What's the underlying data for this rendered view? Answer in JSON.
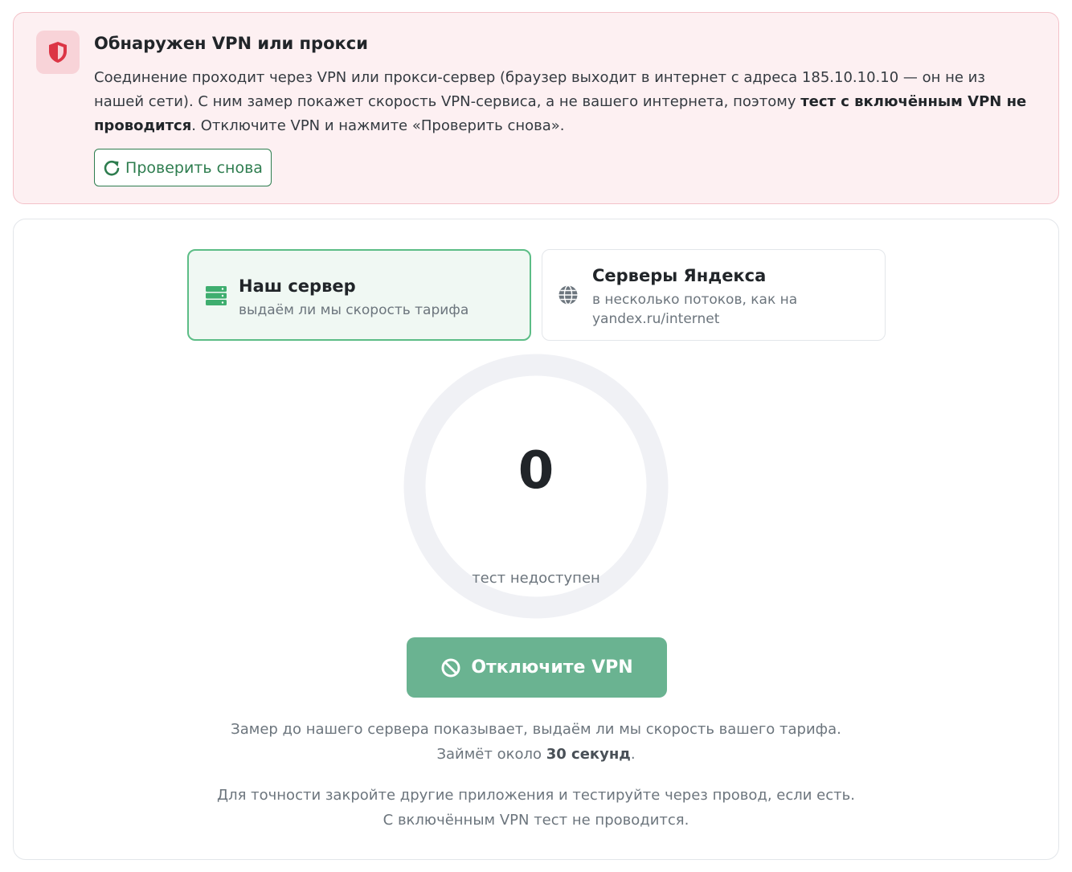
{
  "alert": {
    "title": "Обнаружен VPN или прокси",
    "text_part1": "Соединение проходит через VPN или прокси-сервер (браузер выходит в интернет с адреса 185.10.10.10 — он не из нашей сети). С ним замер покажет скорость VPN-сервиса, а не вашего интернета, поэтому ",
    "text_bold": "тест с включённым VPN не проводится",
    "text_part2": ". Отключите VPN и нажмите «Проверить снова».",
    "retry_label": "Проверить снова",
    "icon": "shield-icon",
    "accent_color": "#dc3545"
  },
  "modes": [
    {
      "title": "Наш сервер",
      "subtitle": "выдаём ли мы скорость тарифа",
      "icon": "server-icon",
      "active": true
    },
    {
      "title": "Серверы Яндекса",
      "subtitle": "в несколько потоков, как на yandex.ru/internet",
      "icon": "globe-icon",
      "active": false
    }
  ],
  "gauge": {
    "value": "0",
    "status": "тест недоступен",
    "fill_fraction": 0
  },
  "start_button": {
    "label": "Отключите VPN",
    "icon": "ban-icon",
    "disabled": true,
    "color": "#6ab391"
  },
  "info": {
    "p1_part1": "Замер до нашего сервера показывает, выдаём ли мы скорость вашего тарифа. Займёт около ",
    "p1_bold": "30 секунд",
    "p1_part2": ".",
    "p2": "Для точности закройте другие приложения и тестируйте через провод, если есть. С включённым VPN тест не проводится."
  }
}
